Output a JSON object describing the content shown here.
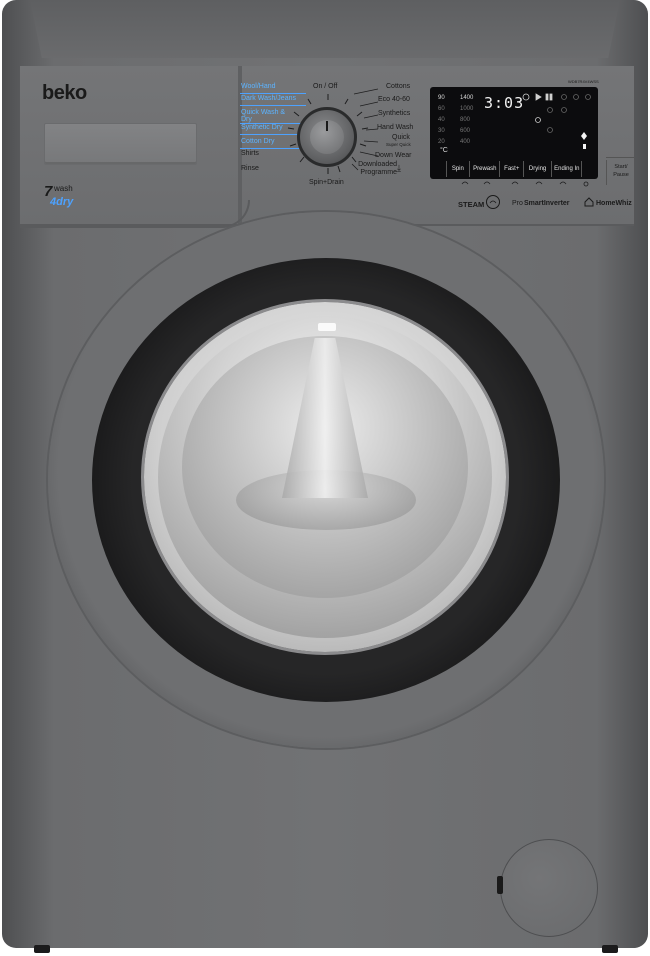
{
  "brand": {
    "logo": "beko",
    "capacity_big": "7",
    "capacity_wash": "wash",
    "capacity_dry": "4dry"
  },
  "programmes_left": [
    {
      "label": "Wool/Hand",
      "highlight": true
    },
    {
      "label": "Dark Wash/Jeans",
      "highlight": true
    },
    {
      "label": "Quick Wash & Dry",
      "highlight": true
    },
    {
      "label": "Synthetic Dry",
      "highlight": true
    },
    {
      "label": "Cotton Dry",
      "highlight": true
    },
    {
      "label": "Shirts",
      "highlight": false
    },
    {
      "label": "Rinse",
      "highlight": false
    }
  ],
  "programmes_right": [
    {
      "label": "Cottons"
    },
    {
      "label": "Eco 40-60"
    },
    {
      "label": "Synthetics"
    },
    {
      "label": "Hand Wash"
    },
    {
      "label": "Quick",
      "sub": "Super Quick"
    },
    {
      "label": "Down Wear"
    },
    {
      "label": "Downloaded Programme"
    }
  ],
  "knob": {
    "top_label": "On / Off",
    "bottom_label": "Spin+Drain"
  },
  "display": {
    "time": "3:03",
    "temps": [
      "90",
      "60",
      "40",
      "30",
      "20"
    ],
    "spins": [
      "1400",
      "1000",
      "800",
      "600",
      "400"
    ],
    "temp_unit": "°C",
    "options": [
      "Spin",
      "Prewash",
      "Fast+",
      "Drying",
      "Ending In"
    ]
  },
  "start_button": {
    "line1": "Start/",
    "line2": "Pause"
  },
  "model": "WDB7R4V4WSS",
  "badges": {
    "steam": "STEAM",
    "inverter_pre": "Pro",
    "inverter_main": "SmartInverter",
    "homewhiz": "HomeWhiz"
  },
  "colors": {
    "body": "#6f7072",
    "display": "#0c0c0e",
    "accent_blue": "#4da2ff"
  }
}
